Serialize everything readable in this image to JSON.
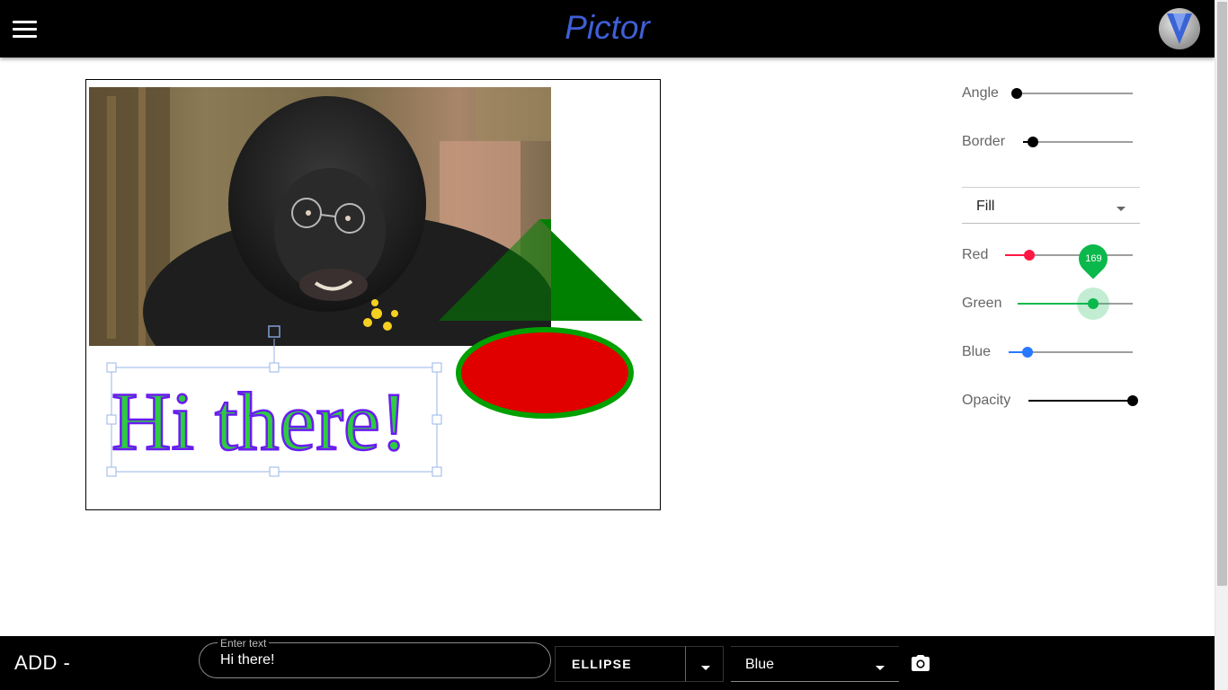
{
  "header": {
    "title": "Pictor",
    "menu_icon": "hamburger-menu-icon",
    "logo_icon": "pictor-logo-icon"
  },
  "canvas": {
    "text_object": "Hi there!",
    "colors": {
      "text_fill": "#2ecc40",
      "text_stroke": "#6a1cf2",
      "triangle": "#008000",
      "ellipse_fill": "#e00000",
      "ellipse_stroke": "#00a000",
      "selection": "#9ab4e8"
    }
  },
  "controls": {
    "angle_label": "Angle",
    "border_label": "Border",
    "fill_select": "Fill",
    "red_label": "Red",
    "green_label": "Green",
    "green_value": "169",
    "blue_label": "Blue",
    "opacity_label": "Opacity",
    "levels": {
      "angle": 0,
      "border": 0.09,
      "red": 0.19,
      "green": 0.66,
      "blue": 0.15,
      "opacity": 1
    },
    "colors": {
      "red": "#ff1744",
      "green": "#0bb84c",
      "blue": "#2979ff",
      "neutral": "#000000"
    }
  },
  "bottom_bar": {
    "add_label": "ADD -",
    "text_field_label": "Enter text",
    "text_field_value": "Hi there!",
    "shape_button": "ELLIPSE",
    "color_select": "Blue",
    "camera_icon": "camera-icon"
  }
}
